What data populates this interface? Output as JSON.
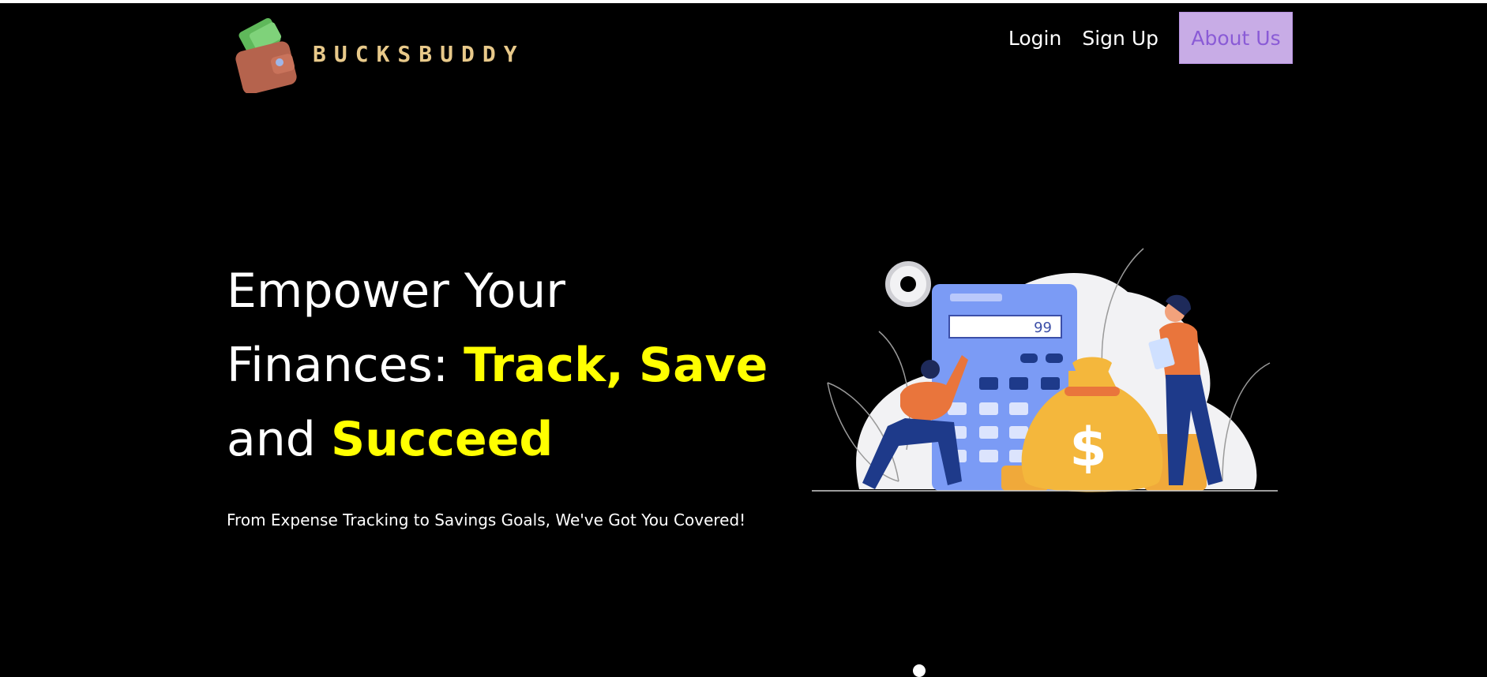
{
  "brand": {
    "name": "BUCKSBUDDY",
    "wallet_icon": "wallet-icon"
  },
  "nav": {
    "login": "Login",
    "signup": "Sign Up",
    "about": "About Us"
  },
  "hero": {
    "line1": "Empower Your",
    "line2_prefix": "Finances:",
    "track": "Track",
    "comma": ",",
    "save": "Save",
    "line3_prefix": "and",
    "succeed": "Succeed",
    "subtitle": "From Expense Tracking to Savings Goals, We've Got You Covered!"
  },
  "illustration": {
    "calculator_display": "99",
    "money_symbol": "$"
  },
  "colors": {
    "highlight": "#ffff00",
    "about_bg": "#c8ace6",
    "about_text": "#8a5bd6",
    "calculator": "#7b9bf5",
    "money_bag": "#f4b73c"
  }
}
